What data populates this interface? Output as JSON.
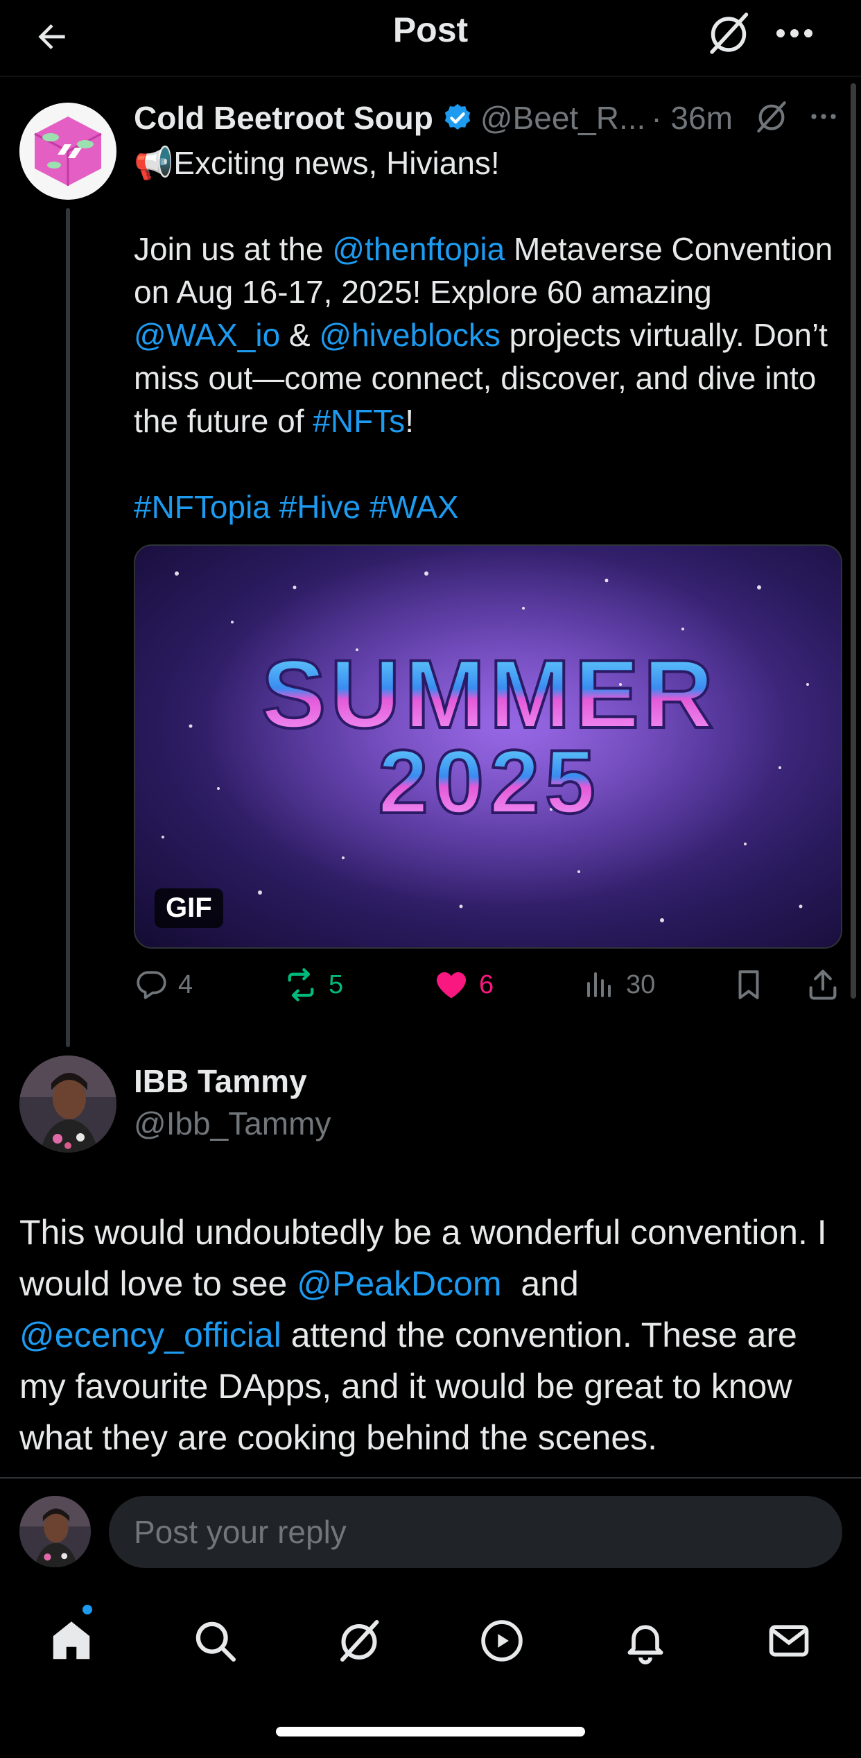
{
  "header": {
    "title": "Post"
  },
  "post": {
    "author_name": "Cold Beetroot Soup",
    "author_handle": "@Beet_R...",
    "time": "· 36m",
    "line1_emoji": "📢",
    "line1_text": "Exciting news, Hivians!",
    "para2": {
      "t1": "Join us at the ",
      "m1": "@thenftopia",
      "t2": " Metaverse Convention on Aug 16-17, 2025! Explore 60 amazing ",
      "m2": "@WAX_io",
      "t3": " & ",
      "m3": "@hiveblocks",
      "t4": " projects virtually. Don’t miss out—come connect, discover, and dive into the future of ",
      "h1": "#NFTs",
      "t5": "!"
    },
    "hashtags": "#NFTopia #Hive #WAX",
    "media": {
      "title_line1": "SUMMER",
      "title_line2": "2025",
      "badge": "GIF"
    },
    "stats": {
      "replies": "4",
      "reposts": "5",
      "likes": "6",
      "views": "30"
    }
  },
  "reply": {
    "author_name": "IBB Tammy",
    "author_handle": "@Ibb_Tammy",
    "b1": "This would undoubtedly be a wonderful convention. I would love to see ",
    "m1": "@PeakDcom",
    "b2": "  and ",
    "m2": "@ecency_official",
    "b3": " attend the convention. These are my favourite DApps, and it would be great to know what they are cooking behind the scenes."
  },
  "composer": {
    "placeholder": "Post your reply"
  },
  "colors": {
    "accent": "#1d9bf0",
    "repost_active": "#00ba7c",
    "like_active": "#f91880"
  },
  "icons": [
    "back-arrow-icon",
    "grok-icon",
    "more-icon",
    "verified-icon",
    "reply-icon",
    "repost-icon",
    "heart-icon",
    "views-icon",
    "bookmark-icon",
    "share-icon",
    "home-icon",
    "search-icon",
    "notifications-icon",
    "video-icon",
    "messages-icon"
  ]
}
